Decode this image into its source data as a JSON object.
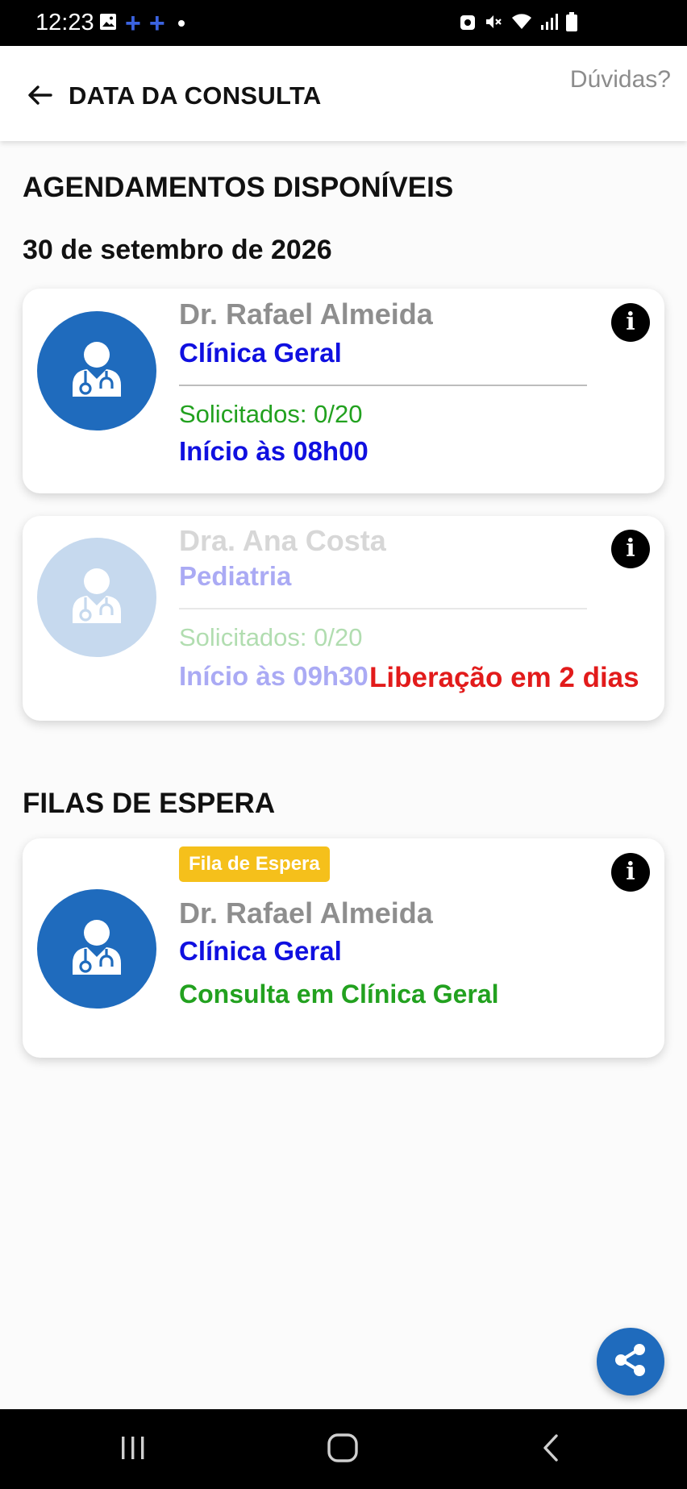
{
  "status_bar": {
    "time": "12:23",
    "left_icons": [
      "gallery-icon",
      "plus-icon",
      "plus-icon",
      "dot-icon"
    ],
    "right_icons": [
      "alarm-icon",
      "mute-icon",
      "wifi-icon",
      "signal-icon",
      "battery-icon"
    ],
    "accent_color": "#3b63e0"
  },
  "header": {
    "title": "DATA DA CONSULTA",
    "help_label": "Dúvidas?",
    "back_icon": "arrow-left-icon"
  },
  "available": {
    "heading": "AGENDAMENTOS DISPONÍVEIS",
    "date": "30 de setembro de 2026",
    "cards": [
      {
        "doctor": "Dr. Rafael Almeida",
        "specialty": "Clínica Geral",
        "requested": "Solicitados: 0/20",
        "start": "Início às 08h00",
        "enabled": true
      },
      {
        "doctor": "Dra. Ana Costa",
        "specialty": "Pediatria",
        "requested": "Solicitados: 0/20",
        "start": "Início às 09h30",
        "release": "Liberação em 2 dias",
        "enabled": false
      }
    ]
  },
  "waitlist": {
    "heading": "FILAS DE ESPERA",
    "cards": [
      {
        "badge": "Fila de Espera",
        "doctor": "Dr. Rafael Almeida",
        "specialty": "Clínica Geral",
        "description": "Consulta em Clínica Geral"
      }
    ]
  },
  "fab": {
    "icon": "share-icon"
  },
  "nav": {
    "buttons": [
      "recent-apps-icon",
      "home-icon",
      "back-icon"
    ]
  },
  "colors": {
    "primary_blue": "#1f6bbd",
    "specialty_blue": "#1010e0",
    "green": "#22a11f",
    "red": "#e21b1b",
    "badge_yellow": "#f5c01b",
    "gray_text": "#8e8e8e"
  }
}
